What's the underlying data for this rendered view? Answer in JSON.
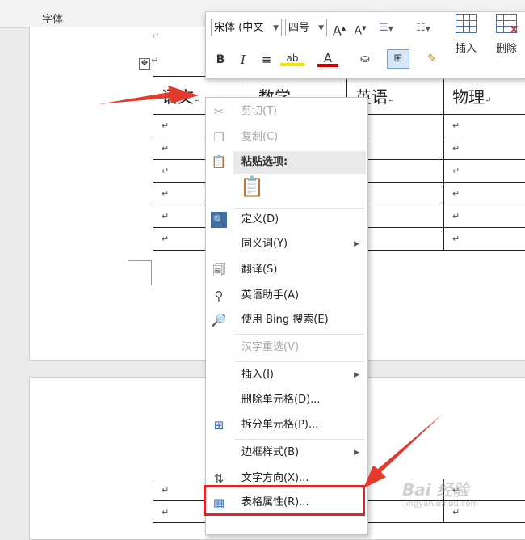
{
  "ribbon": {
    "group_label": "字体"
  },
  "mini_toolbar": {
    "font_name": "宋体 (中文",
    "font_size": "四号",
    "grow_font": "A",
    "shrink_font": "A",
    "bold": "B",
    "italic": "I",
    "font_color": "A",
    "insert_label": "插入",
    "delete_label": "删除"
  },
  "table": {
    "headers": [
      "语文",
      "数学",
      "英语",
      "物理"
    ],
    "para_mark": "↵"
  },
  "context_menu": {
    "items": {
      "cut": "剪切(T)",
      "copy": "复制(C)",
      "paste_options": "粘贴选项:",
      "define": "定义(D)",
      "synonyms": "同义词(Y)",
      "translate": "翻译(S)",
      "english_assistant": "英语助手(A)",
      "bing_search": "使用 Bing 搜索(E)",
      "hanzi_reselect": "汉字重选(V)",
      "insert": "插入(I)",
      "delete_cells": "删除单元格(D)...",
      "split_cells": "拆分单元格(P)...",
      "border_styles": "边框样式(B)",
      "text_direction": "文字方向(X)...",
      "table_properties": "表格属性(R)..."
    }
  },
  "watermark": {
    "text": "Bai 经验",
    "sub": "jingyan.baidu.com"
  },
  "colors": {
    "highlight": "#d9262a",
    "arrow": "#e23b2e",
    "font_color_bar": "#d40000",
    "highlight_color_bar": "#f2e600"
  }
}
